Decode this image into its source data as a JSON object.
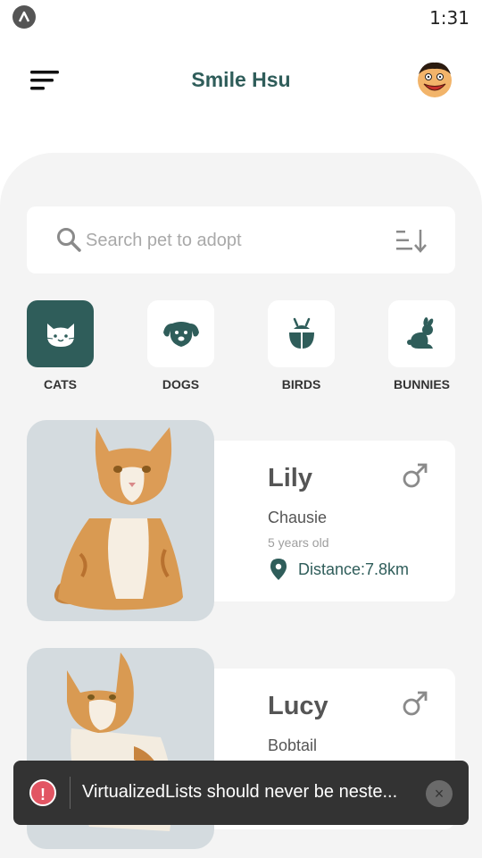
{
  "status_bar": {
    "time": "1:31",
    "app_icon": "expo-icon"
  },
  "header": {
    "title": "Smile Hsu",
    "menu_icon": "menu-icon",
    "avatar_icon": "cartoon-avatar"
  },
  "search": {
    "placeholder": "Search pet to adopt",
    "value": "",
    "search_icon": "search-icon",
    "sort_icon": "sort-icon"
  },
  "categories": [
    {
      "label": "CATS",
      "icon": "cat-icon",
      "active": true
    },
    {
      "label": "DOGS",
      "icon": "dog-icon",
      "active": false
    },
    {
      "label": "BIRDS",
      "icon": "bird-icon",
      "active": false
    },
    {
      "label": "BUNNIES",
      "icon": "rabbit-icon",
      "active": false
    }
  ],
  "pets": [
    {
      "name": "Lily",
      "breed": "Chausie",
      "age": "5 years old",
      "distance": "Distance:7.8km",
      "gender_icon": "male-icon"
    },
    {
      "name": "Lucy",
      "breed": "Bobtail",
      "gender_icon": "male-icon"
    }
  ],
  "toast": {
    "message": "VirtualizedLists should never be neste...",
    "error_icon": "!",
    "close_icon": "×"
  },
  "colors": {
    "accent": "#2f5d5a",
    "panel": "#f4f4f4",
    "toast_bg": "#333333",
    "error": "#e25563"
  }
}
